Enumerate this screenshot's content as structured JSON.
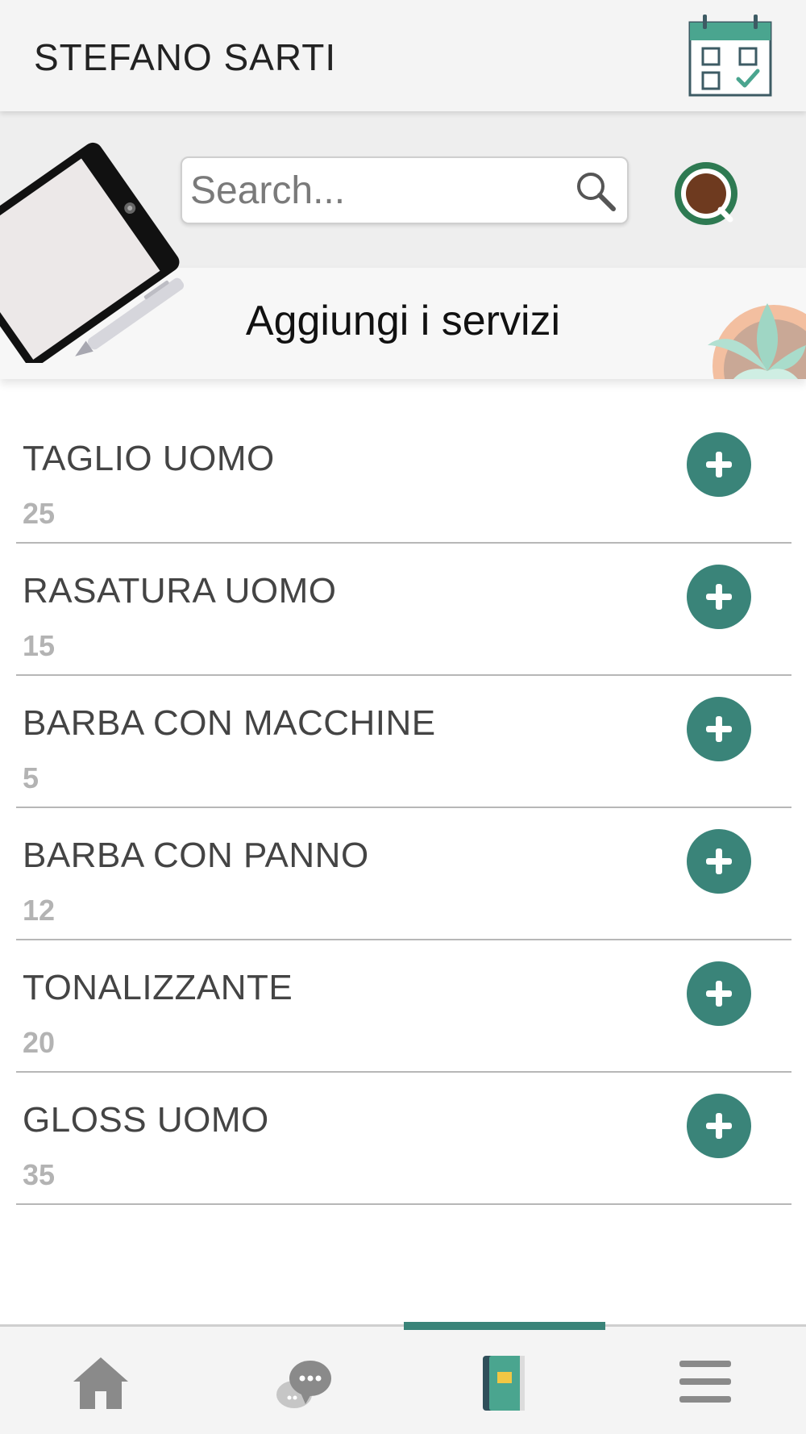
{
  "header": {
    "user_name": "STEFANO SARTI",
    "calendar_icon": "calendar-check-icon"
  },
  "search": {
    "placeholder": "Search...",
    "icon": "search-icon"
  },
  "page": {
    "title": "Aggiungi i servizi"
  },
  "services": [
    {
      "name": "TAGLIO UOMO",
      "price": "25"
    },
    {
      "name": "RASATURA UOMO",
      "price": "15"
    },
    {
      "name": "BARBA CON MACCHINE",
      "price": "5"
    },
    {
      "name": "BARBA CON PANNO",
      "price": "12"
    },
    {
      "name": "TONALIZZANTE",
      "price": "20"
    },
    {
      "name": "GLOSS UOMO",
      "price": "35"
    }
  ],
  "bottom_nav": {
    "items": [
      "home-icon",
      "chat-icon",
      "services-book-icon",
      "menu-icon"
    ],
    "active_index": 2
  },
  "colors": {
    "accent": "#3a8479",
    "header_bg": "#f4f4f4",
    "search_zone_bg": "#eeeeee",
    "price_text": "#b3b3b3",
    "divider": "#b7b7b7"
  }
}
